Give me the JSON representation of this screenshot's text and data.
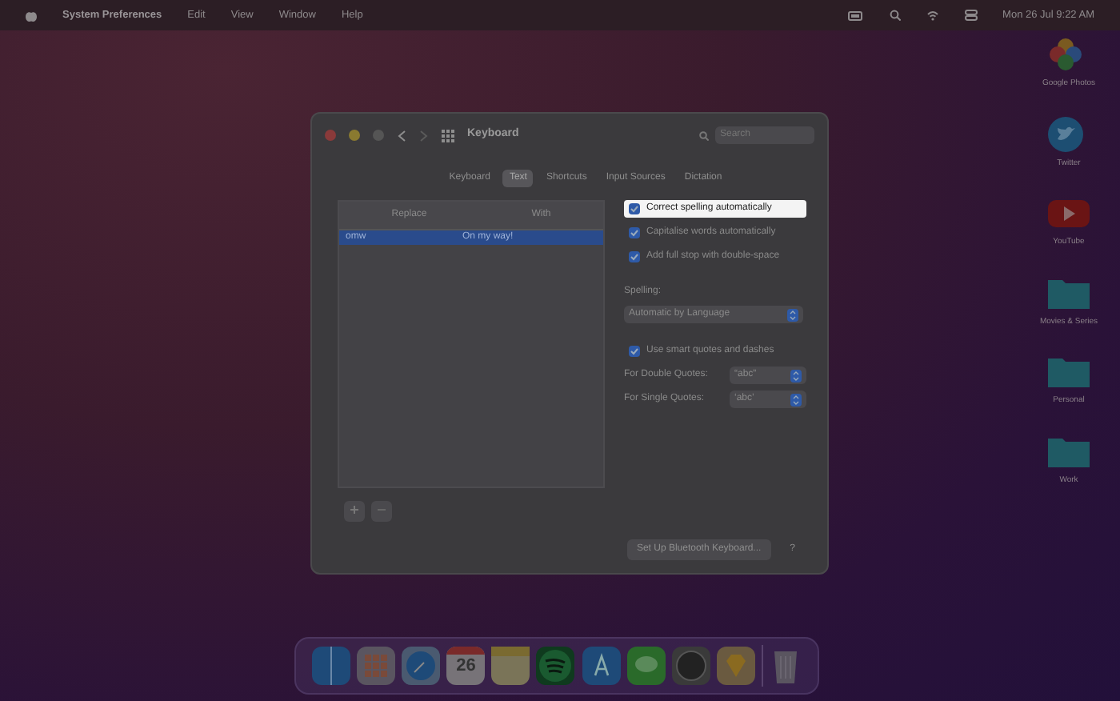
{
  "menu_bar": {
    "app": "System Preferences",
    "menus": [
      "Edit",
      "View",
      "Window",
      "Help"
    ],
    "clock": "Mon 26 Jul  9:22 AM"
  },
  "window": {
    "title": "Keyboard",
    "search": {
      "placeholder": "Search"
    },
    "tabs": [
      {
        "label": "Keyboard",
        "selected": false
      },
      {
        "label": "Text",
        "selected": true
      },
      {
        "label": "Shortcuts",
        "selected": false
      },
      {
        "label": "Input Sources",
        "selected": false
      },
      {
        "label": "Dictation",
        "selected": false
      }
    ],
    "table": {
      "columns": [
        "Replace",
        "With"
      ],
      "rows": [
        {
          "cells": [
            "omw",
            "On my way!"
          ],
          "selected": true
        }
      ]
    },
    "options": [
      {
        "label": "Correct spelling automatically",
        "checked": true,
        "highlighted": true
      },
      {
        "label": "Capitalise words automatically",
        "checked": true,
        "highlighted": false
      },
      {
        "label": "Add full stop with double-space",
        "checked": true,
        "highlighted": false
      }
    ],
    "spelling": {
      "label": "Spelling:",
      "value": "Automatic by Language"
    },
    "smart_quotes": {
      "label": "Use smart quotes and dashes",
      "checked": true
    },
    "quotes": [
      {
        "label": "For Double Quotes:",
        "value": "“abc”"
      },
      {
        "label": "For Single Quotes:",
        "value": "‘abc’"
      }
    ],
    "bluetooth_button": "Set Up Bluetooth Keyboard...",
    "help_button": "?"
  },
  "desktop_icons": [
    {
      "kind": "photos",
      "label": "Google Photos"
    },
    {
      "kind": "twitter",
      "label": "Twitter"
    },
    {
      "kind": "youtube",
      "label": "YouTube"
    },
    {
      "kind": "folder",
      "label": "Movies & Series"
    },
    {
      "kind": "folder",
      "label": "Personal"
    },
    {
      "kind": "folder",
      "label": "Work"
    }
  ],
  "dock": {
    "calendar_day": "26"
  }
}
